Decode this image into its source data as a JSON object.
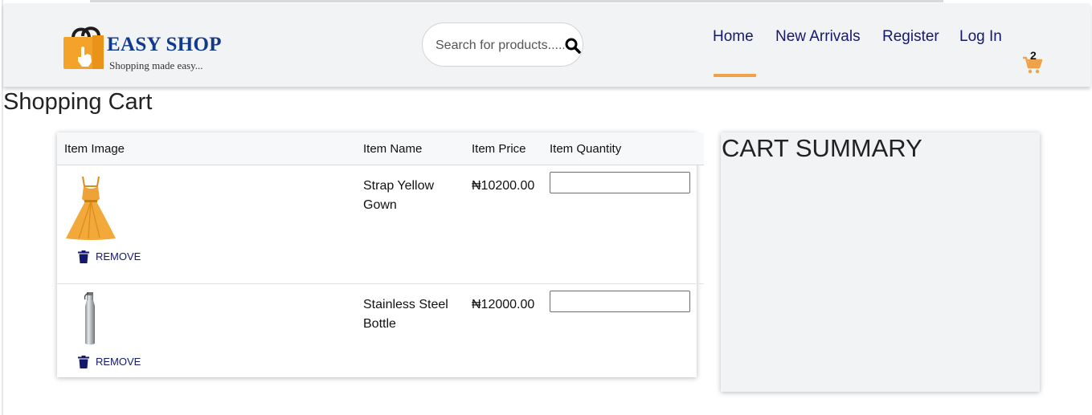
{
  "brand": {
    "name": "EASY SHOP",
    "tagline": "Shopping made easy..."
  },
  "search": {
    "placeholder": "Search for products....."
  },
  "nav": {
    "items": [
      {
        "label": "Home",
        "active": true
      },
      {
        "label": "New Arrivals"
      },
      {
        "label": "Register"
      },
      {
        "label": "Log In"
      }
    ],
    "cart_count": "2",
    "active_underline_color": "#f0a24a",
    "link_color": "#15196b"
  },
  "page": {
    "title": "Shopping Cart"
  },
  "cart_table": {
    "headers": [
      "Item Image",
      "Item Name",
      "Item Price",
      "Item Quantity"
    ],
    "items": [
      {
        "image_icon": "yellow-gown-image",
        "name": "Strap Yellow Gown",
        "price": "₦10200.00",
        "quantity": "",
        "remove_label": "REMOVE"
      },
      {
        "image_icon": "steel-bottle-image",
        "name": "Stainless Steel Bottle",
        "price": "₦12000.00",
        "quantity": "",
        "remove_label": "REMOVE"
      }
    ]
  },
  "summary": {
    "title": "CART SUMMARY"
  },
  "colors": {
    "header_bg": "#f2f3f5",
    "brand_blue": "#123a8a",
    "bag_orange": "#f4a32a"
  }
}
